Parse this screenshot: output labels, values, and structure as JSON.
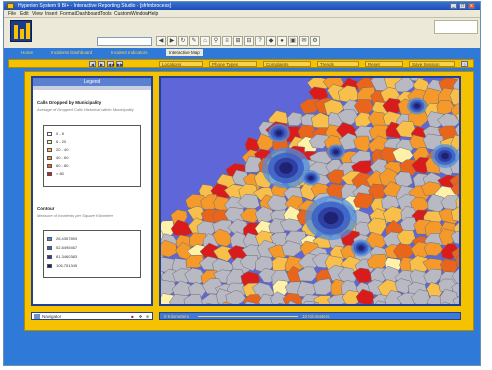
{
  "window": {
    "title": "Hyperion System 9 BI+ - Interactive Reporting Studio - [sfrlmbrocess]",
    "controls": [
      "_",
      "□",
      "x"
    ]
  },
  "menu": [
    "File",
    "Edit",
    "View",
    "Insert",
    "Format",
    "Dashboard",
    "Tools",
    "Custom",
    "Window",
    "Help"
  ],
  "toolbar": {
    "search_value": "",
    "buttons": [
      "◀",
      "▶",
      "↻",
      "✎",
      "⌂",
      "⚲",
      "≡",
      "⊞",
      "⊟",
      "?",
      "◆",
      "●",
      "▣",
      "✉",
      "⚙"
    ]
  },
  "tabs": [
    {
      "label": "Home",
      "active": false
    },
    {
      "label": "Incidents Dashboard",
      "active": false
    },
    {
      "label": "Incident Indicators",
      "active": false
    },
    {
      "label": "Interactive Map",
      "active": true
    }
  ],
  "filters": {
    "nav_buttons": [
      "◀",
      "▶",
      "◀◀",
      "▶▶"
    ],
    "dropdowns": [
      "Locations",
      "Phone Types",
      "Complaints",
      "Trends",
      "Reset"
    ],
    "save_label": "Save Session",
    "help_label": "?"
  },
  "legend": {
    "title": "Legend",
    "layer1": {
      "heading": "Calls Dropped by Municipality",
      "subtitle": "Average of Dropped Calls Historical within Municipality",
      "classes": [
        {
          "label": "0 - 6",
          "color": "#ffffff"
        },
        {
          "label": "6 - 20",
          "color": "#fff2a8"
        },
        {
          "label": "20 - 40",
          "color": "#f8c04a"
        },
        {
          "label": "40 - 60",
          "color": "#f59a2a"
        },
        {
          "label": "60 - 80",
          "color": "#e8651b"
        },
        {
          "label": "> 80",
          "color": "#d91b1b"
        }
      ]
    },
    "layer2": {
      "heading": "Contour",
      "subtitle": "Measure of Incidents per Square Kilometer",
      "classes": [
        {
          "label": "26.4357893",
          "color": "#4f8fe0"
        },
        {
          "label": "52.8495467",
          "color": "#3a5fc8"
        },
        {
          "label": "81.3460383",
          "color": "#2a3a9a"
        },
        {
          "label": "106.751345",
          "color": "#1b1d6b"
        }
      ]
    }
  },
  "navigator": {
    "label": "Navigator"
  },
  "scale": {
    "left": "0 Kilometers",
    "right": "10 Kilometers"
  },
  "colors": {
    "accent_blue": "#2f7ad8",
    "frame_yellow": "#f4c200",
    "sea": "#5f66d8",
    "land_gray": "#b9b9c4"
  }
}
